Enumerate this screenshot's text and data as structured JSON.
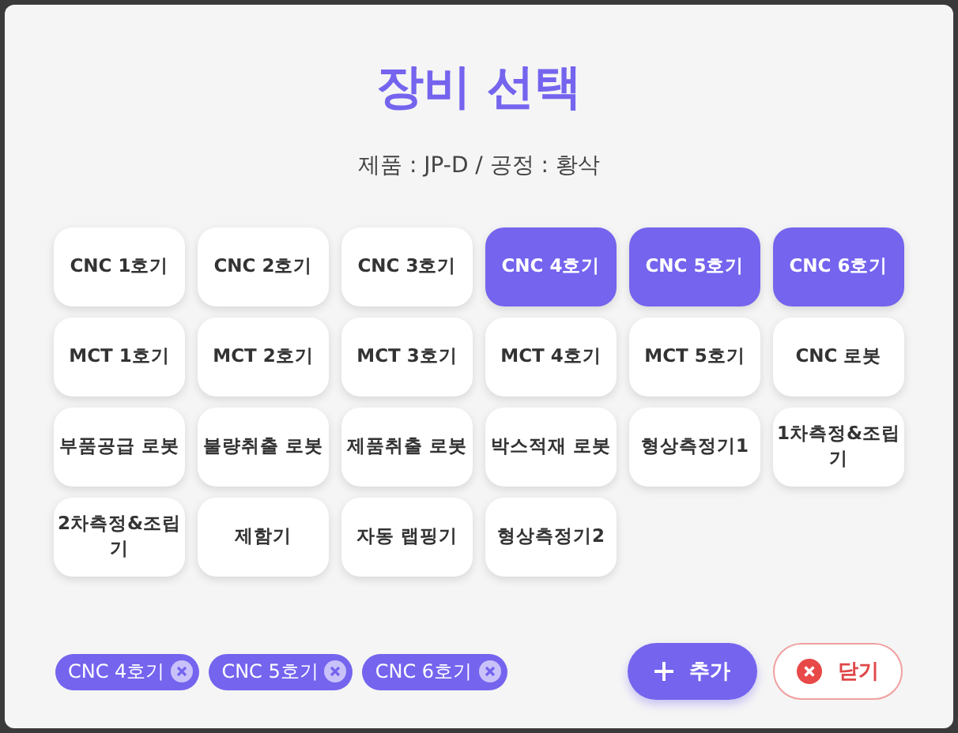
{
  "dialog": {
    "title": "장비 선택",
    "subtitle": "제품 : JP-D / 공정 : 황삭"
  },
  "equipment": [
    {
      "label": "CNC 1호기",
      "selected": false
    },
    {
      "label": "CNC 2호기",
      "selected": false
    },
    {
      "label": "CNC 3호기",
      "selected": false
    },
    {
      "label": "CNC 4호기",
      "selected": true
    },
    {
      "label": "CNC 5호기",
      "selected": true
    },
    {
      "label": "CNC 6호기",
      "selected": true
    },
    {
      "label": "MCT 1호기",
      "selected": false
    },
    {
      "label": "MCT 2호기",
      "selected": false
    },
    {
      "label": "MCT 3호기",
      "selected": false
    },
    {
      "label": "MCT 4호기",
      "selected": false
    },
    {
      "label": "MCT 5호기",
      "selected": false
    },
    {
      "label": "CNC 로봇",
      "selected": false
    },
    {
      "label": "부품공급 로봇",
      "selected": false
    },
    {
      "label": "불량취출 로봇",
      "selected": false
    },
    {
      "label": "제품취출 로봇",
      "selected": false
    },
    {
      "label": "박스적재 로봇",
      "selected": false
    },
    {
      "label": "형상측정기1",
      "selected": false
    },
    {
      "label": "1차측정&조립기",
      "selected": false
    },
    {
      "label": "2차측정&조립기",
      "selected": false
    },
    {
      "label": "제함기",
      "selected": false
    },
    {
      "label": "자동 랩핑기",
      "selected": false
    },
    {
      "label": "형상측정기2",
      "selected": false
    }
  ],
  "chips": [
    "CNC 4호기",
    "CNC 5호기",
    "CNC 6호기"
  ],
  "buttons": {
    "add": "추가",
    "close": "닫기"
  }
}
